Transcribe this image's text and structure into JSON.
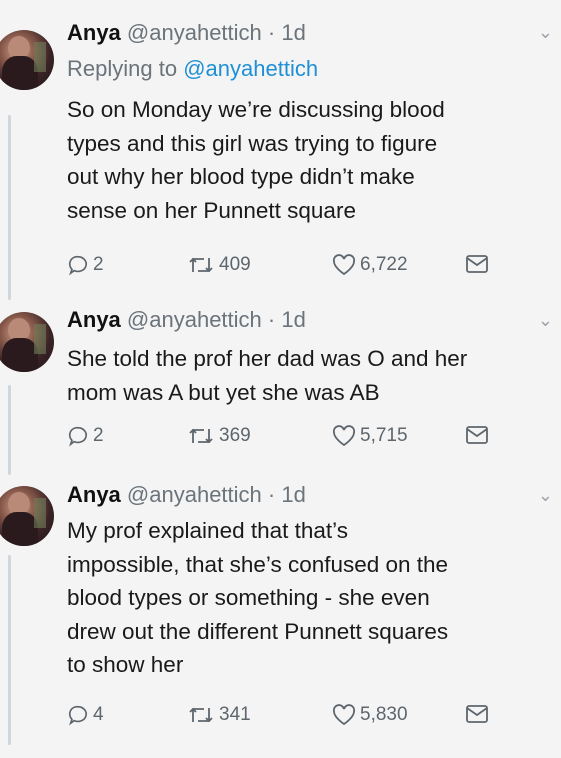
{
  "tweets": [
    {
      "name": "Anya",
      "handle": "@anyahettich",
      "time": "· 1d",
      "reply_prefix": "Replying to",
      "reply_to": "@anyahettich",
      "text": "So on Monday we’re discussing blood\ntypes and this girl was trying to figure\nout why her blood type didn’t make\nsense on her Punnett square",
      "replies": "2",
      "retweets": "409",
      "likes": "6,722"
    },
    {
      "name": "Anya",
      "handle": "@anyahettich",
      "time": "· 1d",
      "text": "She told the prof her dad was O and her\nmom was A but yet she was AB",
      "replies": "2",
      "retweets": "369",
      "likes": "5,715"
    },
    {
      "name": "Anya",
      "handle": "@anyahettich",
      "time": "· 1d",
      "text": "My prof explained that that’s\nimpossible, that she’s confused on the\nblood types or something - she even\ndrew out the different Punnett squares\nto show her",
      "replies": "4",
      "retweets": "341",
      "likes": "5,830"
    }
  ],
  "icons": {
    "reply": "reply-bubble-icon",
    "retweet": "retweet-icon",
    "like": "heart-icon",
    "dm": "envelope-icon",
    "more": "chevron-down-icon"
  },
  "colors": {
    "link": "#1f8fd6",
    "muted": "#6b737b",
    "thread_line": "#cfd6dc"
  }
}
